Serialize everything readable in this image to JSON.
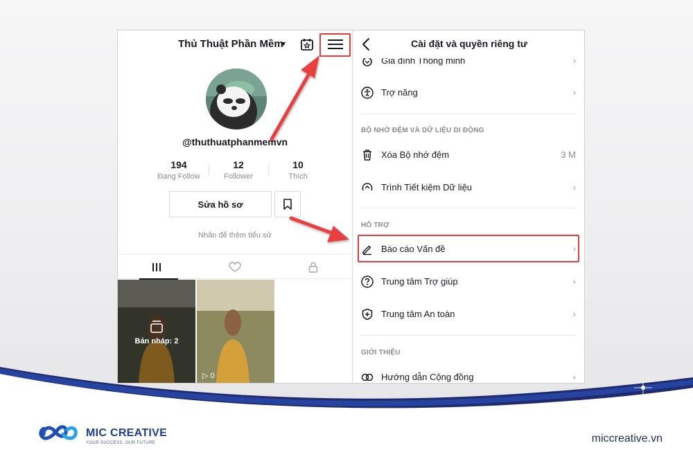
{
  "profile": {
    "account_name": "Thủ Thuật Phần Mềm",
    "handle": "@thuthuatphanmemvn",
    "stats": [
      {
        "value": "194",
        "label": "Đang Follow"
      },
      {
        "value": "12",
        "label": "Follower"
      },
      {
        "value": "10",
        "label": "Thích"
      }
    ],
    "edit_profile_label": "Sửa hồ sơ",
    "bio_hint": "Nhấn để thêm tiểu sử",
    "tabs": [
      {
        "icon": "grid-icon"
      },
      {
        "icon": "liked-videos-icon"
      },
      {
        "icon": "lock-icon"
      }
    ],
    "videos": [
      {
        "label": "Bản nháp: 2",
        "icon": "draft-icon"
      },
      {
        "views": "0",
        "icon": "play-icon"
      }
    ]
  },
  "settings": {
    "title": "Cài đặt và quyền riêng tư",
    "items_top": [
      {
        "label": "Gia đình Thông minh",
        "icon": "family-pairing-icon"
      },
      {
        "label": "Trợ năng",
        "icon": "accessibility-icon"
      }
    ],
    "sections": [
      {
        "header": "BỘ NHỚ ĐỆM VÀ DỮ LIỆU DI ĐỘNG",
        "items": [
          {
            "label": "Xóa Bộ nhớ đệm",
            "value": "3 M",
            "icon": "trash-icon"
          },
          {
            "label": "Trình Tiết kiệm Dữ liệu",
            "icon": "data-saver-icon"
          }
        ]
      },
      {
        "header": "HỖ TRỢ",
        "items": [
          {
            "label": "Báo cáo Vấn đề",
            "icon": "pencil-icon",
            "highlighted": true
          },
          {
            "label": "Trung tâm Trợ giúp",
            "icon": "help-icon"
          },
          {
            "label": "Trung tâm An toàn",
            "icon": "shield-icon"
          }
        ]
      },
      {
        "header": "GIỚI THIỆU",
        "items": [
          {
            "label": "Hướng dẫn Cộng đồng",
            "icon": "community-icon"
          }
        ]
      }
    ]
  },
  "annotations": {
    "highlight_color": "#e33c3c",
    "arrow_color": "#e33c3c"
  },
  "footer": {
    "brand": "MIC CREATIVE",
    "tagline": "YOUR SUCCESS, OUR FUTURE",
    "website": "miccreative.vn",
    "colors": {
      "navy": "#1f2a6e",
      "accent": "#2b57c9"
    }
  }
}
